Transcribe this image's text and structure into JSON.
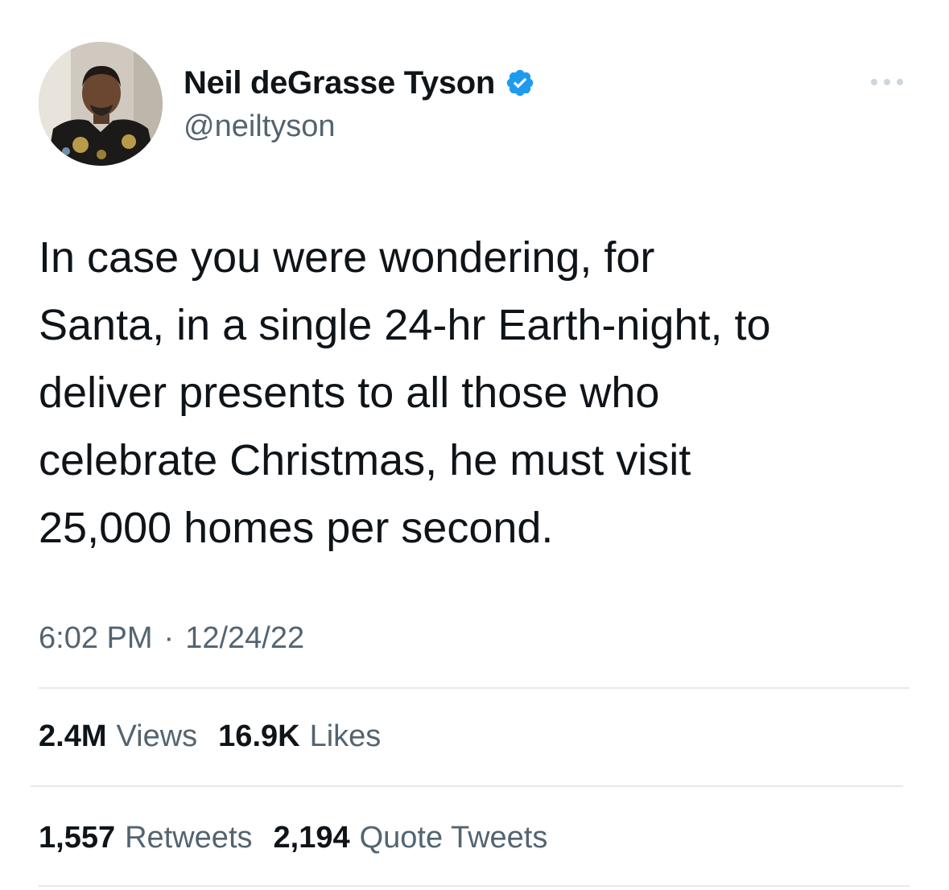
{
  "author": {
    "display_name": "Neil deGrasse Tyson",
    "handle": "@neiltyson",
    "verified": true,
    "verified_color": "#1d9bf0"
  },
  "tweet": {
    "text": "In case you were wondering, for\nSanta, in a single 24-hr Earth-night, to\ndeliver presents to all those who\ncelebrate Christmas, he must visit\n25,000 homes per second.",
    "time": "6:02 PM",
    "separator": "·",
    "date": "12/24/22"
  },
  "stats": {
    "views": {
      "value": "2.4M",
      "label": "Views"
    },
    "likes": {
      "value": "16.9K",
      "label": "Likes"
    },
    "retweets": {
      "value": "1,557",
      "label": "Retweets"
    },
    "quotes": {
      "value": "2,194",
      "label": "Quote Tweets"
    }
  },
  "icons": {
    "more": "more-horizontal-icon",
    "verified": "verified-badge-icon",
    "avatar": "profile-photo"
  },
  "colors": {
    "text_primary": "#0f1419",
    "text_secondary": "#536471",
    "divider": "#e6e9ec"
  }
}
